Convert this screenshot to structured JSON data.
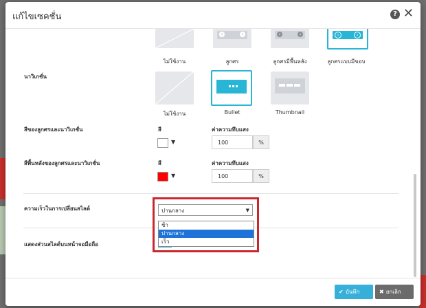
{
  "modal": {
    "title": "แก้ไขเซคชั่น"
  },
  "arrows": {
    "options": [
      {
        "label": "ไม่ใช้งาน"
      },
      {
        "label": "ลูกศร"
      },
      {
        "label": "ลูกศรมีพื้นหลัง"
      },
      {
        "label": "ลูกศรแบบมีขอบ"
      }
    ]
  },
  "navigation": {
    "label": "นาวิเกชั่น",
    "options": [
      {
        "label": "ไม่ใช้งาน"
      },
      {
        "label": "Bullet"
      },
      {
        "label": "Thumbnail"
      }
    ]
  },
  "arrow_nav_color": {
    "label": "สีของลูกศรและนาวิเกชั่น",
    "color_label": "สี",
    "color": "#ffffff",
    "opacity_label": "ค่าความทึบแสง",
    "opacity": "100",
    "unit": "%"
  },
  "arrow_nav_bg": {
    "label": "สีพื้นหลังของลูกศรและนาวิเกชั่น",
    "color_label": "สี",
    "color": "#ff0000",
    "opacity_label": "ค่าความทึบแสง",
    "opacity": "100",
    "unit": "%"
  },
  "slide_speed": {
    "label": "ความเร็วในการเปลี่ยนสไลด์",
    "selected": "ปานกลาง",
    "options": [
      "ช้า",
      "ปานกลาง",
      "เร็ว"
    ]
  },
  "mobile_show": {
    "label": "แสดงส่วนสไลด์บนหน้าจอมือถือ"
  },
  "footer": {
    "save_label": "บันทึก",
    "cancel_label": "ยกเลิก"
  },
  "colors": {
    "accent": "#29b6d6",
    "highlight": "#c8272e",
    "selected_option": "#1e73d8"
  }
}
